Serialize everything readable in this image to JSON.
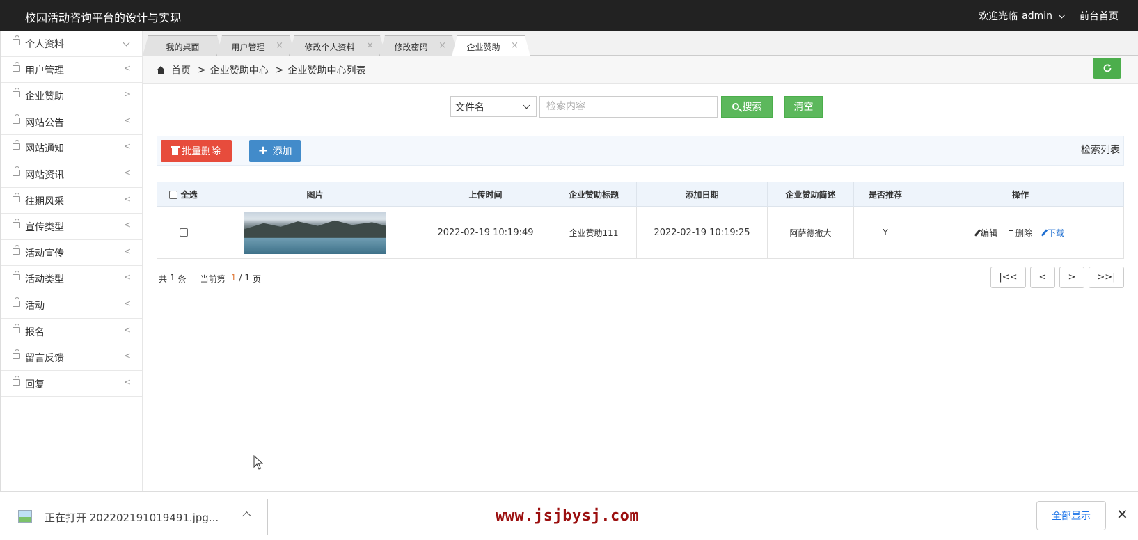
{
  "header": {
    "app_title": "校园活动咨询平台的设计与实现",
    "welcome": "欢迎光临",
    "username": "admin",
    "front_link": "前台首页"
  },
  "sidebar": {
    "items": [
      {
        "label": "个人资料",
        "arrow": "down"
      },
      {
        "label": "用户管理",
        "arrow": "<"
      },
      {
        "label": "企业赞助",
        "arrow": ">"
      },
      {
        "label": "网站公告",
        "arrow": "<"
      },
      {
        "label": "网站通知",
        "arrow": "<"
      },
      {
        "label": "网站资讯",
        "arrow": "<"
      },
      {
        "label": "往期风采",
        "arrow": "<"
      },
      {
        "label": "宣传类型",
        "arrow": "<"
      },
      {
        "label": "活动宣传",
        "arrow": "<"
      },
      {
        "label": "活动类型",
        "arrow": "<"
      },
      {
        "label": "活动",
        "arrow": "<"
      },
      {
        "label": "报名",
        "arrow": "<"
      },
      {
        "label": "留言反馈",
        "arrow": "<"
      },
      {
        "label": "回复",
        "arrow": "<"
      }
    ]
  },
  "tabs": [
    {
      "label": "我的桌面",
      "close": ""
    },
    {
      "label": "用户管理",
      "close": "×"
    },
    {
      "label": "修改个人资料",
      "close": "×"
    },
    {
      "label": "修改密码",
      "close": "×"
    },
    {
      "label": "企业赞助",
      "close": "×",
      "active": true
    }
  ],
  "breadcrumb": {
    "home": "首页",
    "sep1": ">",
    "level1": "企业赞助中心",
    "sep2": ">",
    "level2": "企业赞助中心列表"
  },
  "search": {
    "field_selected": "文件名",
    "placeholder": "检索内容",
    "search_label": "搜索",
    "clear_label": "清空"
  },
  "toolbar": {
    "batch_delete_label": "批量删除",
    "add_label": "添加",
    "list_label": "检索列表"
  },
  "table": {
    "headers": {
      "select_all": "全选",
      "image": "图片",
      "upload_time": "上传时间",
      "title": "企业赞助标题",
      "add_date": "添加日期",
      "summary": "企业赞助简述",
      "recommended": "是否推荐",
      "actions": "操作"
    },
    "rows": [
      {
        "upload_time": "2022-02-19 10:19:49",
        "title": "企业赞助111",
        "add_date": "2022-02-19 10:19:25",
        "summary": "阿萨德撒大",
        "recommended": "Y",
        "edit_label": "编辑",
        "delete_label": "删除",
        "download_label": "下载"
      }
    ]
  },
  "pager": {
    "total_prefix": "共",
    "total": "1",
    "total_suffix": "条",
    "current_prefix": "当前第",
    "current": "1",
    "slash": "/",
    "pages": "1",
    "pages_suffix": "页",
    "first_label": "|<<",
    "prev_label": "<",
    "next_label": ">",
    "last_label": ">>|"
  },
  "download_bar": {
    "file_text": "正在打开 202202191019491.jpg...",
    "watermark": "www.jsjbysj.com",
    "show_all_label": "全部显示",
    "close_label": "✕"
  },
  "colors": {
    "header_bg": "#222222",
    "success": "#5cb85c",
    "danger": "#e74c3c",
    "primary": "#428bca",
    "watermark": "#9b0f0f"
  }
}
